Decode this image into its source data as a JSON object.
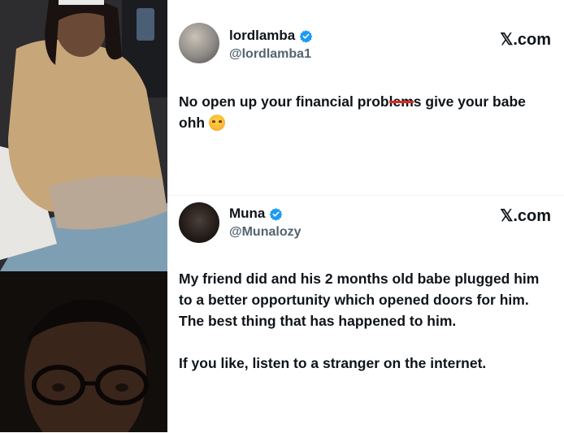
{
  "tweets": [
    {
      "display_name": "lordlamba",
      "handle": "@lordlamba1",
      "source": "𝕏.com",
      "text_before_strike": "No open up your financial prob",
      "text_struck": "lem",
      "text_after_strike": "s give your babe ohh",
      "emoji": "laughing-face"
    },
    {
      "display_name": "Muna",
      "handle": "@Munalozy",
      "source": "𝕏.com",
      "paragraph_1": "My friend did and his 2 months old babe plugged him to a better opportunity which opened doors for him. The best thing that has happened to him.",
      "paragraph_2": "If you like, listen to a stranger on the internet."
    }
  ],
  "colors": {
    "verified": "#1d9bf0",
    "text": "#0f1419",
    "handle": "#536471",
    "strike": "#e0291f"
  }
}
